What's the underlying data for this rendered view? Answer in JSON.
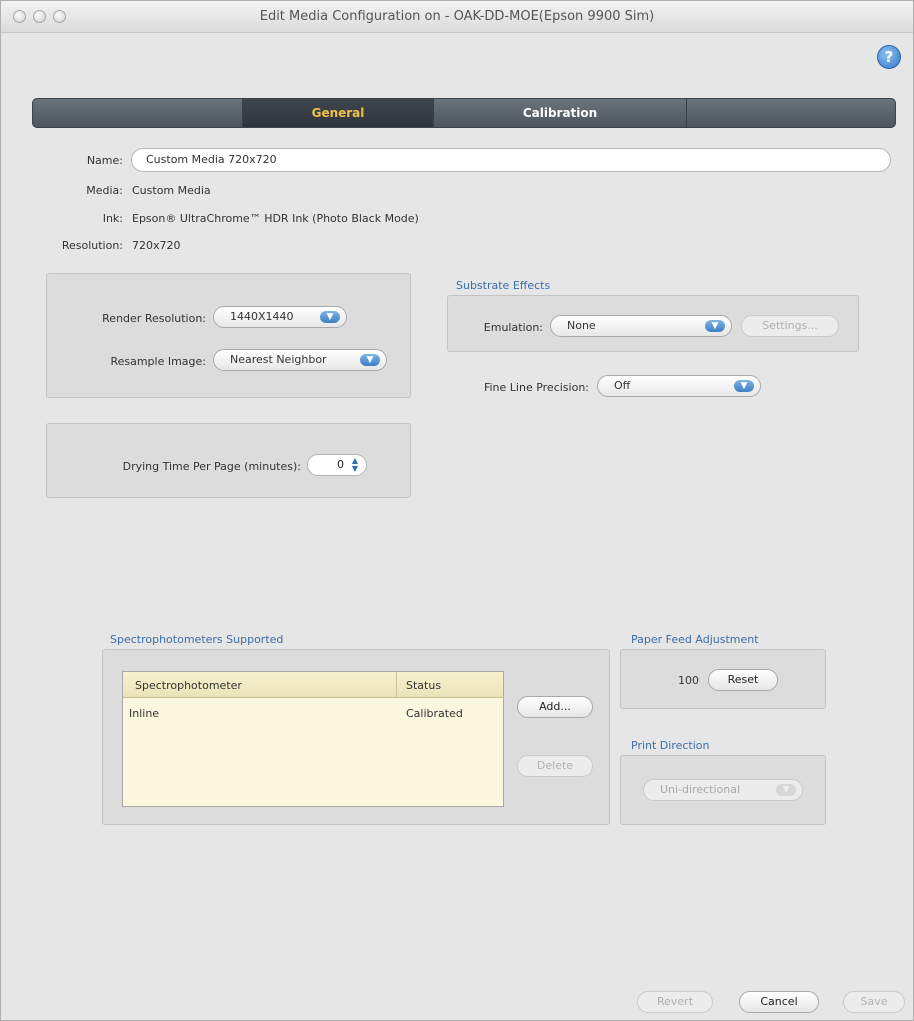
{
  "window": {
    "title": "Edit Media Configuration on - OAK-DD-MOE(Epson 9900 Sim)"
  },
  "tabs": [
    {
      "label": "General",
      "active": true
    },
    {
      "label": "Calibration",
      "active": false
    }
  ],
  "info": {
    "name_label": "Name:",
    "name_value": "Custom Media 720x720",
    "media_label": "Media:",
    "media_value": "Custom Media",
    "ink_label": "Ink:",
    "ink_value": "Epson® UltraChrome™ HDR Ink (Photo Black Mode)",
    "resolution_label": "Resolution:",
    "resolution_value": "720x720"
  },
  "render": {
    "render_resolution_label": "Render Resolution:",
    "render_resolution_value": "1440X1440",
    "resample_label": "Resample Image:",
    "resample_value": "Nearest Neighbor"
  },
  "drying": {
    "label": "Drying Time Per Page (minutes):",
    "value": "0"
  },
  "substrate": {
    "title": "Substrate Effects",
    "emulation_label": "Emulation:",
    "emulation_value": "None",
    "settings_label": "Settings..."
  },
  "fine_line": {
    "label": "Fine Line Precision:",
    "value": "Off"
  },
  "spectro": {
    "title": "Spectrophotometers Supported",
    "columns": [
      "Spectrophotometer",
      "Status"
    ],
    "rows": [
      {
        "name": "Inline",
        "status": "Calibrated"
      }
    ],
    "add_label": "Add...",
    "delete_label": "Delete"
  },
  "paper_feed": {
    "title": "Paper Feed Adjustment",
    "value": "100",
    "reset_label": "Reset"
  },
  "print_direction": {
    "title": "Print Direction",
    "value": "Uni-directional"
  },
  "footer": {
    "revert_label": "Revert",
    "cancel_label": "Cancel",
    "save_label": "Save"
  },
  "colors": {
    "accent_tab": "#f0c14b",
    "group_title": "#3a6ea8",
    "help_blue": "#2f79c9"
  }
}
